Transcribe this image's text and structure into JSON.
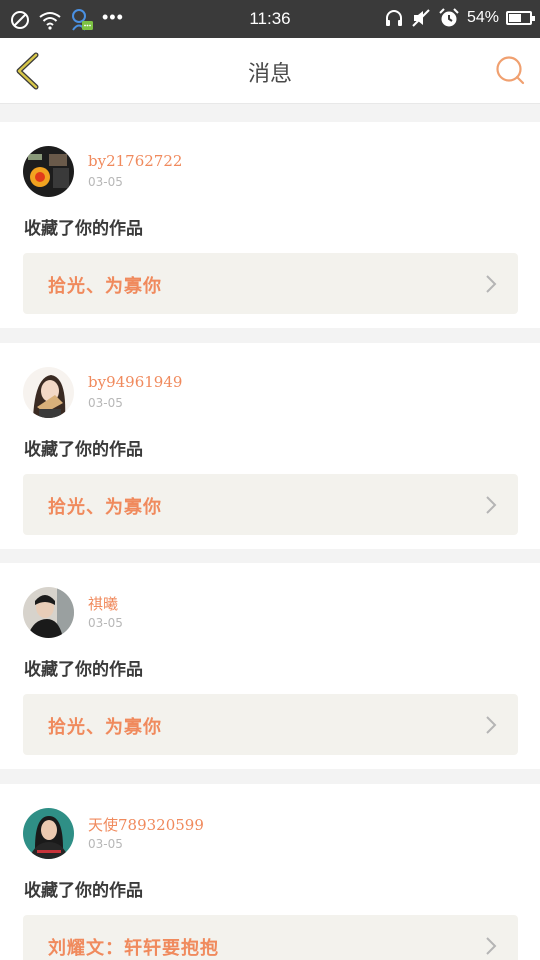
{
  "status_bar": {
    "time": "11:36",
    "battery": "54%",
    "battery_level": 0.54,
    "left_icons": [
      "do-not-disturb-icon",
      "wifi-icon",
      "notification-app-icon",
      "more-dots-icon"
    ],
    "right_icons": [
      "headphones-icon",
      "mute-icon",
      "alarm-icon",
      "battery-icon"
    ]
  },
  "header": {
    "title": "消息",
    "back_icon": "chevron-left-icon",
    "search_icon": "search-icon"
  },
  "colors": {
    "accent": "#f08a5d",
    "back_arrow": "#c8b33a",
    "card_bg": "#ffffff",
    "work_box_bg": "#f3f2ed",
    "page_bg": "#f3f3f3",
    "status_bar_bg": "#3a3a3a"
  },
  "messages": [
    {
      "username": "by21762722",
      "date": "03-05",
      "action": "收藏了你的作品",
      "work_title": "拾光、为寡你"
    },
    {
      "username": "by94961949",
      "date": "03-05",
      "action": "收藏了你的作品",
      "work_title": "拾光、为寡你"
    },
    {
      "username": "祺曦",
      "date": "03-05",
      "action": "收藏了你的作品",
      "work_title": "拾光、为寡你"
    },
    {
      "username": "天使789320599",
      "date": "03-05",
      "action": "收藏了你的作品",
      "work_title": "刘耀文：轩轩要抱抱"
    }
  ]
}
